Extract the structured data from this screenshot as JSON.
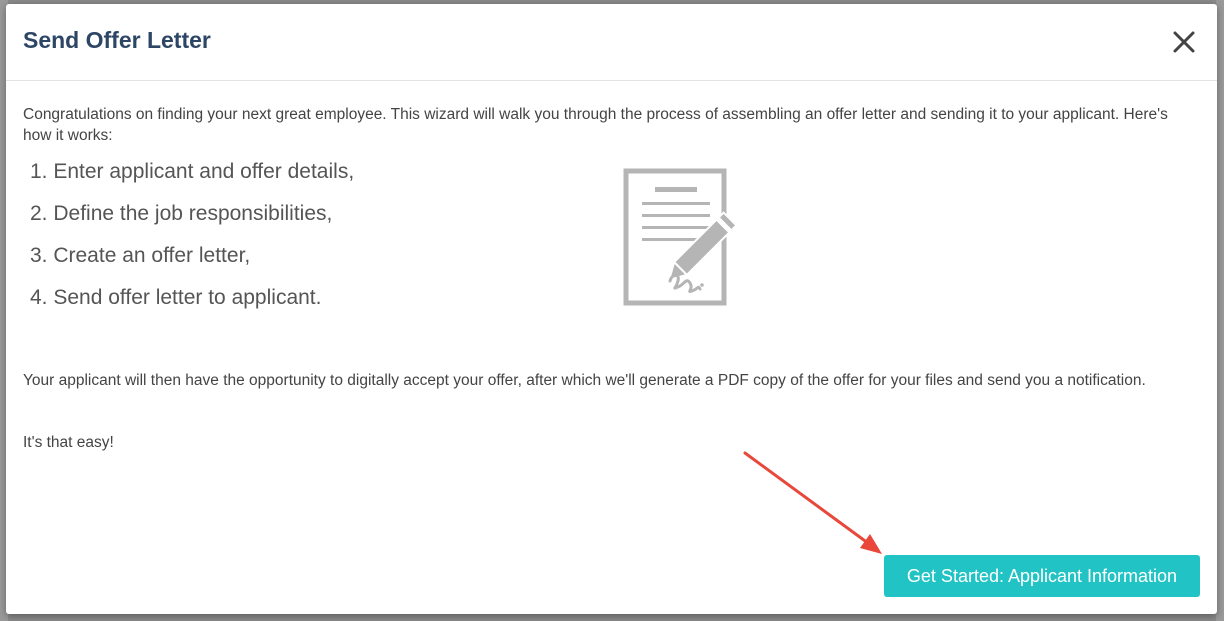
{
  "modal": {
    "title": "Send Offer Letter",
    "close_icon": "close-icon",
    "intro": "Congratulations on finding your next great employee. This wizard will walk you through the process of assembling an offer letter and sending it to your applicant. Here's how it works:",
    "steps": [
      "1. Enter applicant and offer details,",
      "2. Define the job responsibilities,",
      "3. Create an offer letter,",
      "4. Send offer letter to applicant."
    ],
    "illustration_icon": "signed-document-icon",
    "followup": "Your applicant will then have the opportunity to digitally accept your offer, after which we'll generate a PDF copy of the offer for your files and send you a notification.",
    "easy": "It's that easy!",
    "cta_label": "Get Started: Applicant Information",
    "annotation_arrow_icon": "red-arrow-icon"
  },
  "colors": {
    "title": "#2d4665",
    "cta_background": "#22c3c4",
    "arrow": "#e8473a",
    "illustration": "#b5b5b5"
  }
}
